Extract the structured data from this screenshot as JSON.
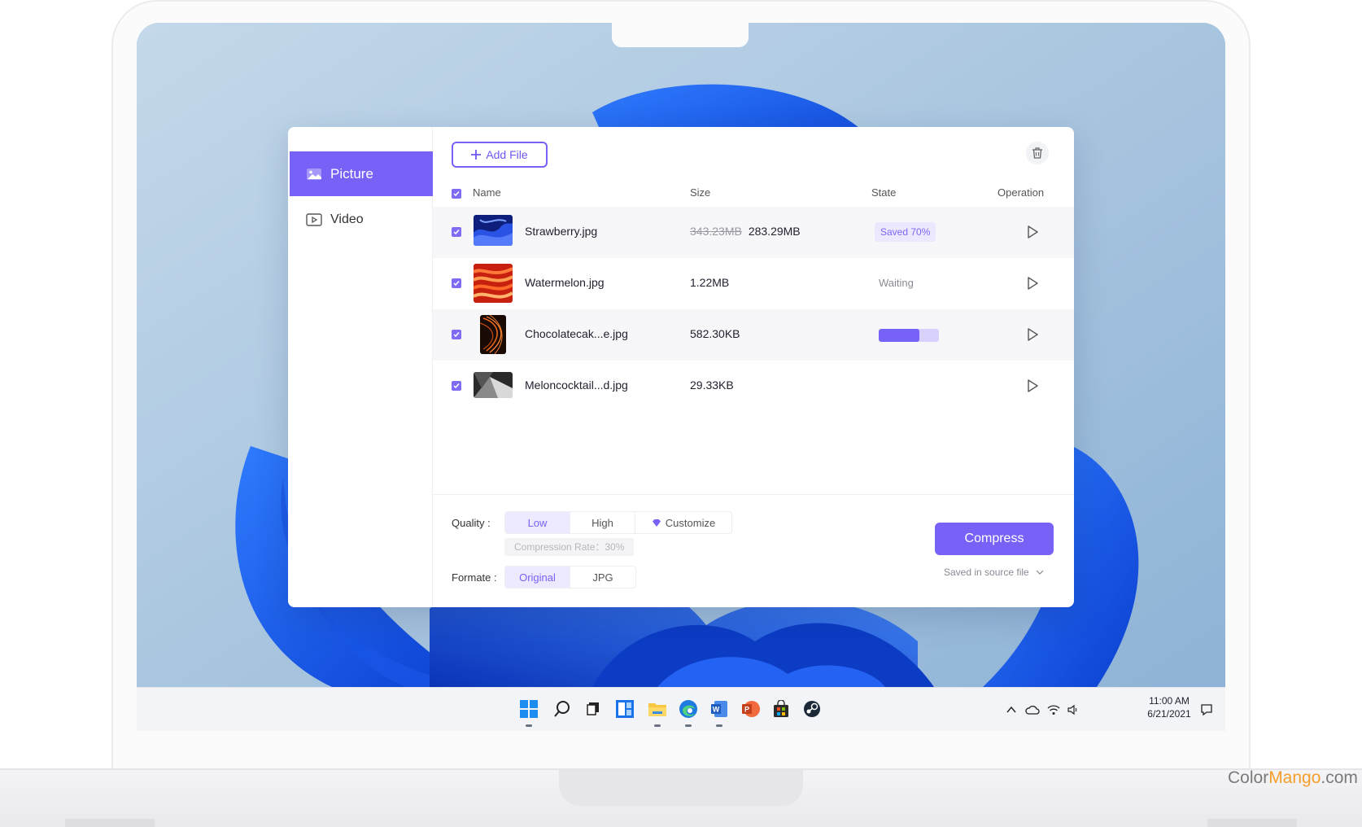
{
  "sidebar": {
    "items": [
      {
        "label": "Picture",
        "icon": "image-icon",
        "active": true
      },
      {
        "label": "Video",
        "icon": "video-icon",
        "active": false
      }
    ]
  },
  "toolbar": {
    "add_file_label": "Add File",
    "delete_icon": "trash-icon"
  },
  "table": {
    "headers": {
      "name": "Name",
      "size": "Size",
      "state": "State",
      "operation": "Operation"
    },
    "rows": [
      {
        "name": "Strawberry.jpg",
        "original_size": "343.23MB",
        "size": "283.29MB",
        "state": "Saved 70%",
        "thumb": "blue-wave"
      },
      {
        "name": "Watermelon.jpg",
        "size": "1.22MB",
        "state": "Waiting",
        "thumb": "red-wave"
      },
      {
        "name": "Chocolatecak...e.jpg",
        "size": "582.30KB",
        "state": "",
        "progress": 0.68,
        "thumb": "orange-lines"
      },
      {
        "name": "Meloncocktail...d.jpg",
        "size": "29.33KB",
        "state": "",
        "thumb": "gray-fold"
      }
    ]
  },
  "settings": {
    "quality_label": "Quality :",
    "quality_options": [
      "Low",
      "High",
      "Customize"
    ],
    "quality_selected": "Low",
    "compression_hint": "Compression Rate：30%",
    "format_label": "Formate :",
    "format_options": [
      "Original",
      "JPG"
    ],
    "format_selected": "Original"
  },
  "actions": {
    "compress_label": "Compress",
    "save_location": "Saved in source file"
  },
  "taskbar": {
    "apps": [
      "start-icon",
      "search-icon",
      "task-view-icon",
      "widgets-icon",
      "file-explorer-icon",
      "edge-icon",
      "word-icon",
      "powerpoint-icon",
      "store-icon",
      "steam-icon"
    ],
    "time": "11:00 AM",
    "date": "6/21/2021"
  },
  "watermark": {
    "part1": "Color",
    "part2": "Mango",
    "part3": ".com"
  },
  "colors": {
    "accent": "#7662f7",
    "accent_light": "#edeaff",
    "badge_bg": "#ece8ff"
  }
}
